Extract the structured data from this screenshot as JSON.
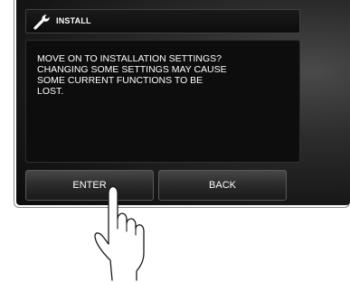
{
  "header": {
    "icon": "wrench-icon",
    "title": "INSTALL"
  },
  "message": {
    "text": "MOVE ON TO INSTALLATION SETTINGS?\nCHANGING SOME SETTINGS MAY CAUSE\nSOME CURRENT FUNCTIONS TO BE\nLOST."
  },
  "buttons": {
    "enter_label": "ENTER",
    "back_label": "BACK"
  },
  "illustration": {
    "icon": "pointing-hand-icon"
  },
  "colors": {
    "screen_background": "#151515",
    "text": "#ffffff",
    "button_face": "#2a2a2a"
  }
}
